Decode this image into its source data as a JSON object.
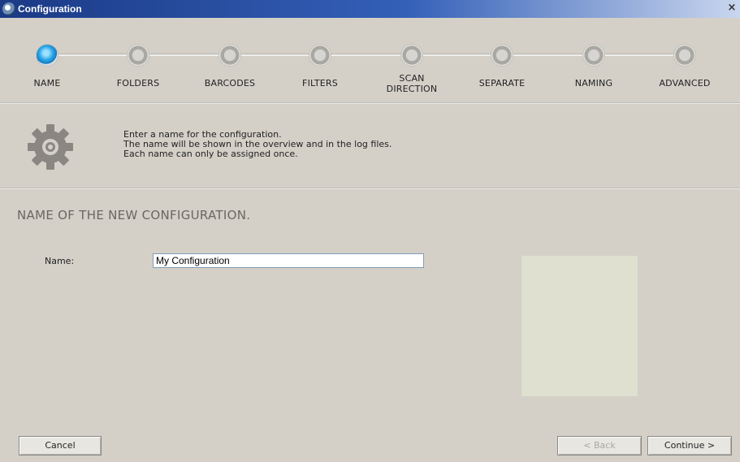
{
  "window": {
    "title": "Configuration",
    "close_glyph": "×"
  },
  "stepper": {
    "active_index": 0,
    "steps": [
      {
        "label": "NAME"
      },
      {
        "label": "FOLDERS"
      },
      {
        "label": "BARCODES"
      },
      {
        "label": "FILTERS"
      },
      {
        "label": "SCAN\nDIRECTION"
      },
      {
        "label": "SEPARATE"
      },
      {
        "label": "NAMING"
      },
      {
        "label": "ADVANCED"
      }
    ]
  },
  "info": {
    "icon": "gear-icon",
    "line1": "Enter a name for the configuration.",
    "line2": "The name will be shown in the overview and in the log files.",
    "line3": "Each name can only be assigned once."
  },
  "main": {
    "section_title": "NAME OF THE NEW CONFIGURATION.",
    "name_label": "Name:",
    "name_value": "My Configuration"
  },
  "buttons": {
    "cancel": "Cancel",
    "back": "< Back",
    "continue": "Continue >"
  },
  "colors": {
    "active_step": "#2aa6e6",
    "background": "#d4d0c8",
    "titlebar": "#1b3a86"
  }
}
